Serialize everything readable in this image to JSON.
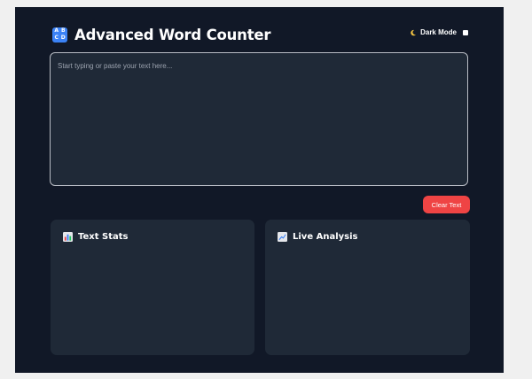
{
  "header": {
    "icon": "abcd-input-icon",
    "icon_letters": [
      "A",
      "B",
      "C",
      "D"
    ],
    "title": "Advanced Word Counter"
  },
  "dark_mode": {
    "icon": "moon-icon",
    "label": "Dark Mode",
    "checked": false
  },
  "editor": {
    "placeholder": "Start typing or paste your text here...",
    "value": ""
  },
  "actions": {
    "clear_label": "Clear Text"
  },
  "panels": [
    {
      "icon": "bar-chart-icon",
      "title": "Text Stats"
    },
    {
      "icon": "trending-chart-icon",
      "title": "Live Analysis"
    }
  ],
  "colors": {
    "page_background": "#111827",
    "panel_background": "#1f2937",
    "accent_blue": "#3b82f6",
    "danger_red": "#ef4444"
  }
}
